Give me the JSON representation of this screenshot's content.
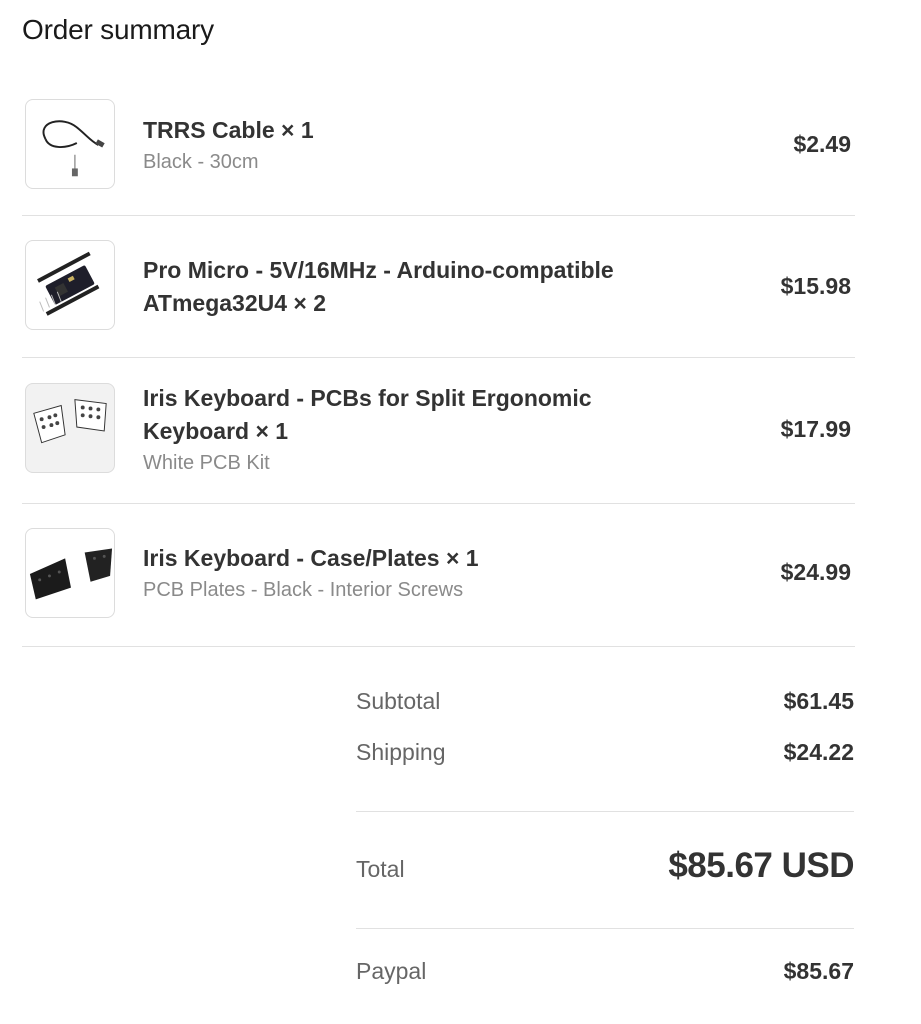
{
  "title": "Order summary",
  "items": [
    {
      "thumbnail_icon": "trrs-cable-image",
      "name": "TRRS Cable × 1",
      "variant": "Black - 30cm",
      "price": "$2.49"
    },
    {
      "thumbnail_icon": "pro-micro-board-image",
      "name": "Pro Micro - 5V/16MHz - Arduino-compatible ATmega32U4 × 2",
      "variant": "",
      "price": "$15.98"
    },
    {
      "thumbnail_icon": "iris-pcb-image",
      "name": "Iris Keyboard - PCBs for Split Ergonomic Keyboard × 1",
      "variant": "White PCB Kit",
      "price": "$17.99"
    },
    {
      "thumbnail_icon": "iris-case-plates-image",
      "name": "Iris Keyboard - Case/Plates × 1",
      "variant": "PCB Plates - Black - Interior Screws",
      "price": "$24.99"
    }
  ],
  "summary": {
    "subtotal_label": "Subtotal",
    "subtotal_value": "$61.45",
    "shipping_label": "Shipping",
    "shipping_value": "$24.22",
    "total_label": "Total",
    "total_value": "$85.67 USD",
    "payment_label": "Paypal",
    "payment_value": "$85.67"
  },
  "colors": {
    "text_primary": "#333333",
    "text_secondary": "#8a8a8a",
    "divider": "#e1e1e1"
  }
}
